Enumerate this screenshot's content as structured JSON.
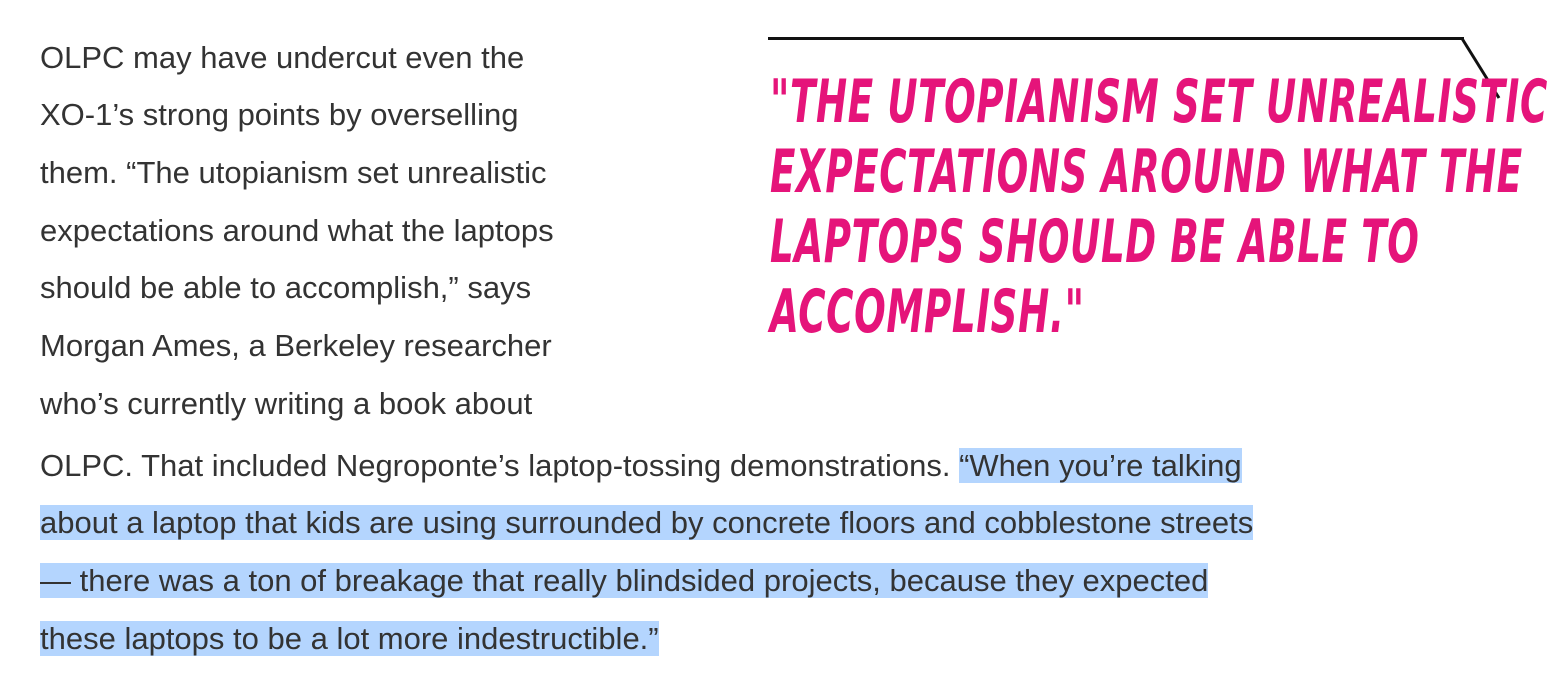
{
  "article": {
    "wrapped_lines": [
      "OLPC may have undercut even the",
      "XO-1’s strong points by overselling",
      "them. “The utopianism set unrealistic",
      "expectations around what the laptops",
      "should be able to accomplish,” says",
      "Morgan Ames, a Berkeley researcher",
      "who’s currently writing a book about"
    ],
    "full_line_1_plain": "OLPC. That included Negroponte’s laptop-tossing demonstrations. ",
    "full_line_1_selected": "“When you’re talking",
    "selected_lines": [
      "about a laptop that kids are using surrounded by concrete floors and cobblestone streets",
      "— there was a ton of breakage that really blindsided projects, because they expected",
      "these laptops to be a lot more indestructible.”"
    ]
  },
  "pull_quote": {
    "lines": [
      "\"The utopianism set unrealistic",
      "expectations around what the",
      "laptops should be able to",
      "accomplish.\""
    ],
    "color": "#e5147a"
  },
  "colors": {
    "body_text": "#333333",
    "selection_highlight": "#b4d5fe",
    "rule": "#111111"
  }
}
